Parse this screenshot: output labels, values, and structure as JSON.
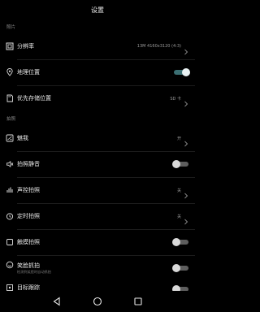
{
  "header": {
    "title": "设置"
  },
  "sections": {
    "photo": {
      "label": "照片"
    },
    "capture": {
      "label": "拍照"
    }
  },
  "settings": {
    "resolution": {
      "label": "分辨率",
      "value": "13M 4160x3120 (4:3)"
    },
    "location": {
      "label": "地理位置",
      "enabled": true
    },
    "storage": {
      "label": "优先存储位置",
      "value": "SD 卡"
    },
    "beauty": {
      "label": "魅我",
      "value": "开"
    },
    "mute": {
      "label": "拍照静音",
      "enabled": false
    },
    "voice": {
      "label": "声控拍照",
      "value": "关"
    },
    "timer": {
      "label": "定时拍照",
      "value": "关"
    },
    "touch": {
      "label": "触摸拍照",
      "enabled": false
    },
    "smile": {
      "label": "笑脸抓拍",
      "sublabel": "检测到笑脸时自动抓拍",
      "enabled": false
    },
    "tracking": {
      "label": "目标跟踪",
      "enabled": false
    }
  },
  "icons": {
    "resolution": "resolution-icon",
    "location": "location-pin-icon",
    "storage": "storage-icon",
    "beauty": "beauty-icon",
    "mute": "mute-icon",
    "voice": "voice-icon",
    "timer": "timer-icon",
    "touch": "touch-icon",
    "smile": "smile-icon",
    "tracking": "tracking-icon"
  },
  "colors": {
    "background": "#000000",
    "toggle_on": "#3b6f73",
    "toggle_off": "#5e5e5e"
  }
}
